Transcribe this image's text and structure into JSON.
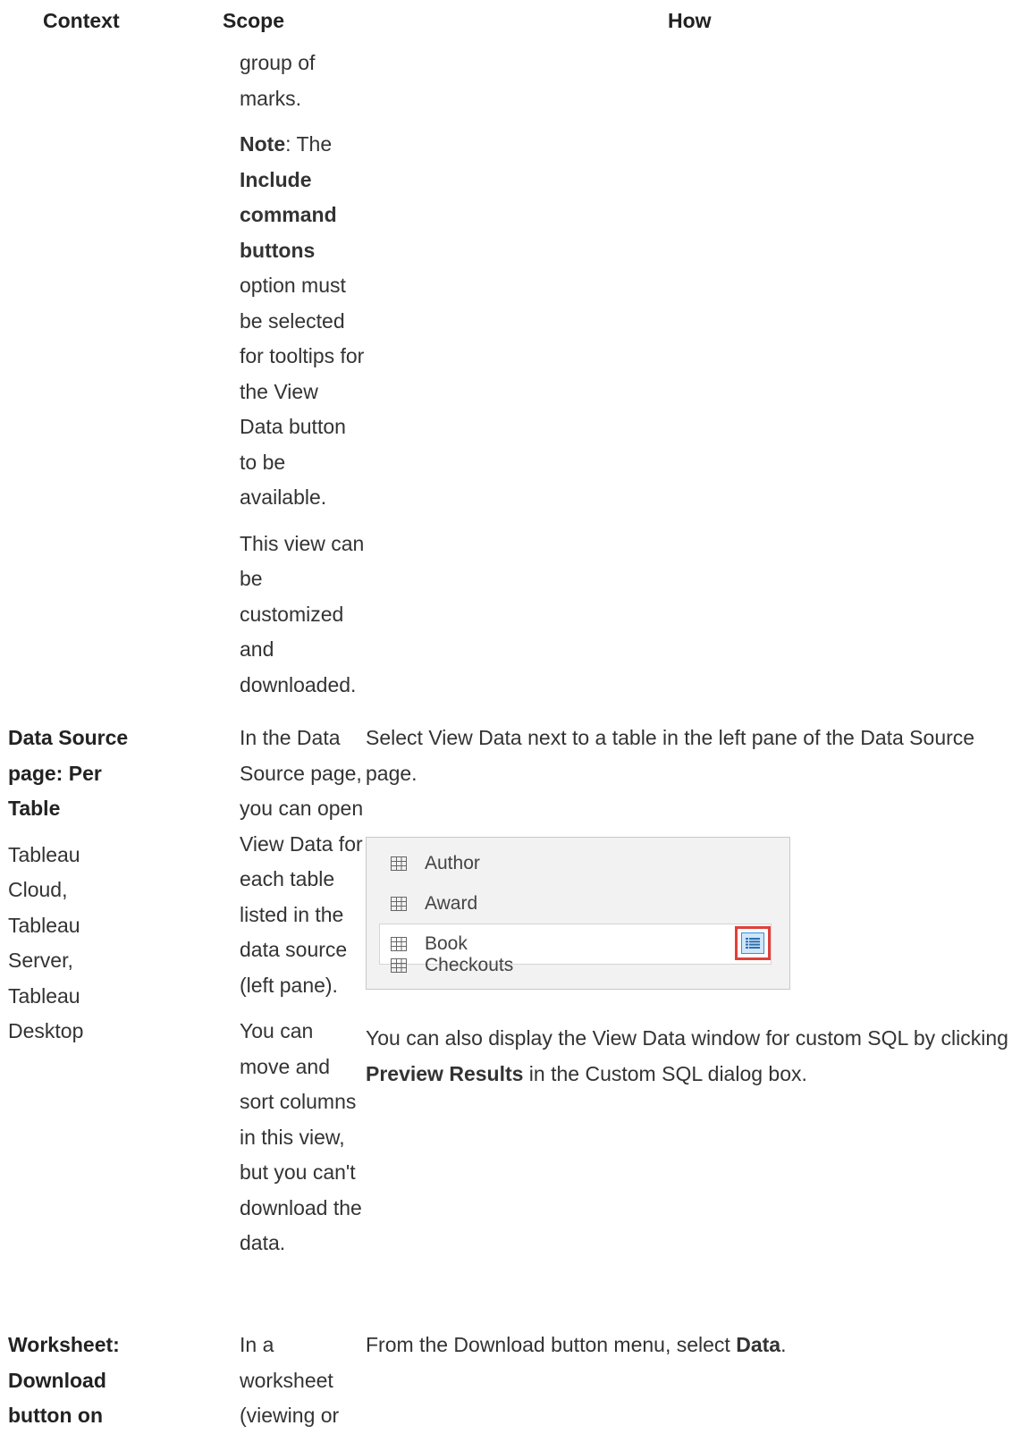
{
  "table": {
    "headers": {
      "context": "Context",
      "scope": "Scope",
      "how": "How"
    }
  },
  "row1": {
    "scope": {
      "p1": "group of marks.",
      "p2_bold1": "Note",
      "p2_text1": ": The ",
      "p2_bold2": "Include command buttons",
      "p2_text2": " option must be selected for tooltips for the View Data button to be available.",
      "p3": "This view can be customized and downloaded."
    }
  },
  "row2": {
    "context_title": "Data Source page: Per Table",
    "context_products": "Tableau Cloud, Tableau Server, Tableau Desktop",
    "scope_p1": "In the Data Source page, you can open View Data for each table listed in the data source (left pane).",
    "scope_p2": "You can move and sort columns in this view, but you can't download the data.",
    "how_p1": "Select View Data next to a table in the left pane of the Data Source page.",
    "how_p2_text1": "You can also display the View Data window for custom SQL by clicking ",
    "how_p2_bold": "Preview Results",
    "how_p2_text2": " in the Custom SQL dialog box.",
    "screenshot": {
      "tables": [
        "Author",
        "Award",
        "Book",
        "Checkouts"
      ],
      "selected_index": 2,
      "icon": "table-grid-icon",
      "view_data_icon": "view-data-icon",
      "highlight_color": "#e0403a"
    }
  },
  "row3": {
    "context_title": "Worksheet: Download button on",
    "scope_p1": "In a worksheet (viewing or",
    "how_text1": "From the Download button menu, select ",
    "how_bold": "Data",
    "how_text2": "."
  }
}
